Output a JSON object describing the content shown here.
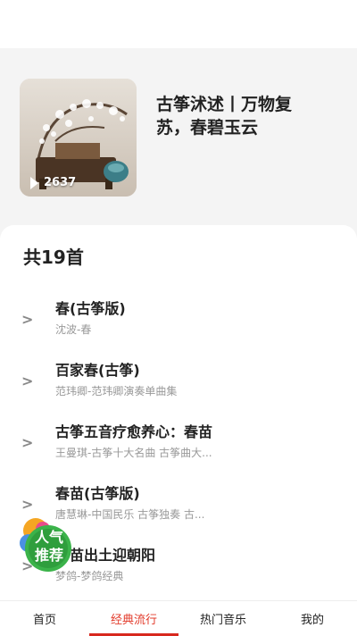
{
  "playlist": {
    "title": "古筝沭述丨万物复苏，春碧玉云",
    "play_count": "2637"
  },
  "songs_header": {
    "count_label": "共19首"
  },
  "songs": [
    {
      "arrow": ">",
      "name": "春(古筝版)",
      "subtitle": "沈波-春"
    },
    {
      "arrow": ">",
      "name": "百家春(古筝)",
      "subtitle": "范玮卿-范玮卿演奏单曲集"
    },
    {
      "arrow": ">",
      "name": "古筝五音疗愈养心：春苗",
      "subtitle": "王曼琪-古筝十大名曲 古筝曲大..."
    },
    {
      "arrow": ">",
      "name": "春苗(古筝版)",
      "subtitle": "唐慧琳-中国民乐 古筝独奏 古..."
    },
    {
      "arrow": ">",
      "name": "春苗出土迎朝阳",
      "subtitle": "梦鸽-梦鸽经典"
    }
  ],
  "badge": {
    "line1": "人气",
    "line2": "推荐"
  },
  "tabs": [
    {
      "label": "首页",
      "active": false
    },
    {
      "label": "经典流行",
      "active": true
    },
    {
      "label": "热门音乐",
      "active": false
    },
    {
      "label": "我的",
      "active": false
    }
  ],
  "colors": {
    "accent": "#d8281e",
    "background": "#f4f4f4"
  },
  "icons": {
    "play": "play-icon",
    "arrow": "chevron-right-icon"
  }
}
